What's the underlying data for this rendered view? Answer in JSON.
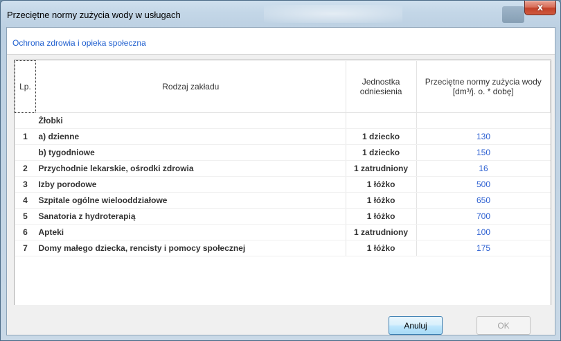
{
  "window": {
    "title": "Przeciętne normy zużycia wody w usługach",
    "close_glyph": "x"
  },
  "section": {
    "title": "Ochrona zdrowia i opieka społeczna"
  },
  "table": {
    "headers": {
      "lp": "Lp.",
      "type": "Rodzaj zakładu",
      "unit": "Jednostka odniesienia",
      "norm": "Przeciętne normy zużycia wody [dm³/j. o. * dobę]"
    },
    "rows": [
      {
        "lp": "",
        "type": "Żłobki",
        "unit": "",
        "norm": ""
      },
      {
        "lp": "1",
        "type": "a) dzienne",
        "unit": "1 dziecko",
        "norm": "130"
      },
      {
        "lp": "",
        "type": "b) tygodniowe",
        "unit": "1 dziecko",
        "norm": "150"
      },
      {
        "lp": "2",
        "type": "Przychodnie lekarskie, ośrodki zdrowia",
        "unit": "1 zatrudniony",
        "norm": "16"
      },
      {
        "lp": "3",
        "type": "Izby porodowe",
        "unit": "1 łóżko",
        "norm": "500"
      },
      {
        "lp": "4",
        "type": "Szpitale ogólne wielooddziałowe",
        "unit": "1 łóżko",
        "norm": "650"
      },
      {
        "lp": "5",
        "type": "Sanatoria z hydroterapią",
        "unit": "1 łóżko",
        "norm": "700"
      },
      {
        "lp": "6",
        "type": "Apteki",
        "unit": "1 zatrudniony",
        "norm": "100"
      },
      {
        "lp": "7",
        "type": "Domy małego dziecka, rencisty i pomocy społecznej",
        "unit": "1 łóżko",
        "norm": "175"
      }
    ]
  },
  "buttons": {
    "cancel": "Anuluj",
    "ok": "OK"
  },
  "colors": {
    "accent_blue": "#2b5fd1",
    "section_title": "#1f5fcf",
    "close_red": "#c2422a"
  }
}
